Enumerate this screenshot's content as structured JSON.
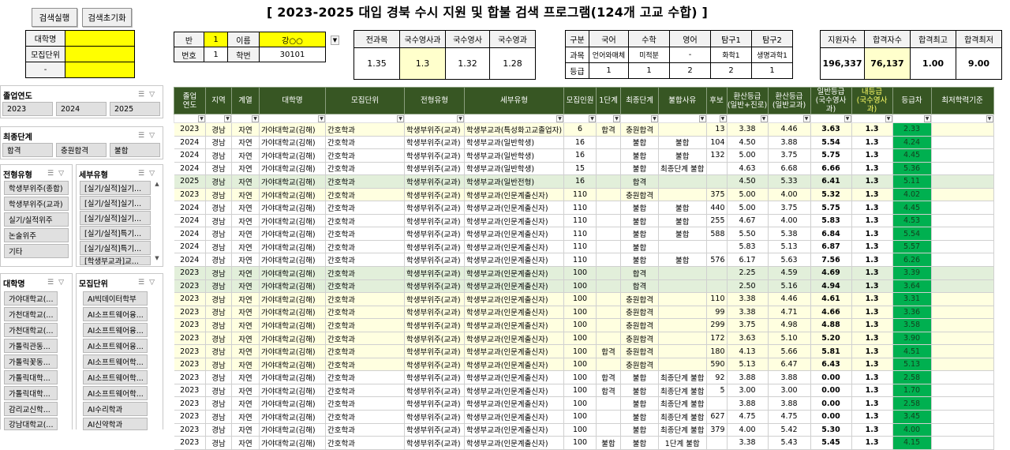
{
  "buttons": {
    "run": "검색실행",
    "reset": "검색초기화"
  },
  "title": "[ 2023-2025 대입 경북 수시 지원 및 합불 검색 프로그램(124개 고교 수합) ]",
  "search_box": {
    "labels": [
      "대학명",
      "모집단위",
      "-"
    ]
  },
  "student": {
    "ban_label": "반",
    "ban": "1",
    "name_label": "이름",
    "name": "강○○",
    "num_label": "번호",
    "num": "1",
    "id_label": "학번",
    "id": "30101"
  },
  "grades": {
    "headers": [
      "전과목",
      "국수영사과",
      "국수영사",
      "국수영과"
    ],
    "values": [
      "1.35",
      "1.3",
      "1.32",
      "1.28"
    ]
  },
  "subjects": {
    "headers": [
      "구분",
      "국어",
      "수학",
      "영어",
      "탐구1",
      "탐구2"
    ],
    "course_label": "과목",
    "courses": [
      "언어와매체",
      "미적분",
      "-",
      "화학1",
      "생명과학1"
    ],
    "grade_label": "등급",
    "grade_vals": [
      "1",
      "1",
      "2",
      "2",
      "1"
    ]
  },
  "stats": {
    "headers": [
      "지원자수",
      "합격자수",
      "합격최고",
      "합격최저"
    ],
    "values": [
      "196,337",
      "76,137",
      "1.00",
      "9.00"
    ]
  },
  "slicers": {
    "year": {
      "title": "졸업연도",
      "items": [
        "2023",
        "2024",
        "2025"
      ]
    },
    "final": {
      "title": "최종단계",
      "items": [
        "합격",
        "충원합격",
        "불합"
      ]
    },
    "type": {
      "title": "전형유형",
      "items": [
        "학생부위주(종합)",
        "학생부위주(교과)",
        "실기/실적위주",
        "논술위주",
        "기타"
      ]
    },
    "detail": {
      "title": "세부유형",
      "items": [
        "[실기/실적]실기...",
        "[실기/실적]실기...",
        "[실기/실적]실기...",
        "[실기/실적]특기...",
        "[실기/실적]특기...",
        "[학생부교과]교..."
      ]
    },
    "univ": {
      "title": "대학명",
      "items": [
        "가야대학교(...",
        "가천대학교(...",
        "가천대학교(...",
        "가톨릭관동...",
        "가톨릭꽃동...",
        "가톨릭대학...",
        "가톨릭대학...",
        "감리교신학...",
        "강남대학교(..."
      ]
    },
    "unit": {
      "title": "모집단위",
      "items": [
        "AI빅데이터학부",
        "AI소프트웨어융...",
        "AI소프트웨어융...",
        "AI소프트웨어융...",
        "AI소프트웨어학...",
        "AI소프트웨어학...",
        "AI소프트웨어학...",
        "AI수리학과",
        "AI신약학과"
      ]
    }
  },
  "table": {
    "headers": [
      "졸업\n연도",
      "지역",
      "계열",
      "대학명",
      "모집단위",
      "전형유형",
      "세부유형",
      "모집인원",
      "1단계",
      "최종단계",
      "불합사유",
      "후보",
      "환산등급\n(일반+진로)",
      "환산등급\n(일반교과)",
      "일반등급\n(국수영사과)",
      "내등급\n(국수영사과)",
      "등급차",
      "최저학력기준"
    ],
    "rows": [
      [
        "2023",
        "경남",
        "자연",
        "가야대학교(김해)",
        "간호학과",
        "학생부위주(교과)",
        "학생부교과(특성화고교졸업자)",
        "6",
        "합격",
        "충원합격",
        "",
        "13",
        "3.38",
        "4.46",
        "3.63",
        "1.3",
        "2.33",
        "",
        "y"
      ],
      [
        "2024",
        "경남",
        "자연",
        "가야대학교(김해)",
        "간호학과",
        "학생부위주(교과)",
        "학생부교과(일반학생)",
        "16",
        "",
        "불합",
        "불합",
        "104",
        "4.50",
        "3.88",
        "5.54",
        "1.3",
        "4.24",
        "",
        "w"
      ],
      [
        "2024",
        "경남",
        "자연",
        "가야대학교(김해)",
        "간호학과",
        "학생부위주(교과)",
        "학생부교과(일반학생)",
        "16",
        "",
        "불합",
        "불합",
        "132",
        "5.00",
        "3.75",
        "5.75",
        "1.3",
        "4.45",
        "",
        "w"
      ],
      [
        "2024",
        "경남",
        "자연",
        "가야대학교(김해)",
        "간호학과",
        "학생부위주(교과)",
        "학생부교과(일반학생)",
        "15",
        "",
        "불합",
        "최종단계 불합",
        "",
        "4.63",
        "6.68",
        "6.66",
        "1.3",
        "5.36",
        "",
        "w"
      ],
      [
        "2025",
        "경남",
        "자연",
        "가야대학교(김해)",
        "간호학과",
        "학생부위주(교과)",
        "학생부교과(일반전형)",
        "16",
        "",
        "합격",
        "",
        "",
        "4.50",
        "5.33",
        "6.41",
        "1.3",
        "5.11",
        "",
        "g"
      ],
      [
        "2023",
        "경남",
        "자연",
        "가야대학교(김해)",
        "간호학과",
        "학생부위주(교과)",
        "학생부교과(인문계출신자)",
        "110",
        "",
        "충원합격",
        "",
        "375",
        "5.00",
        "4.00",
        "5.32",
        "1.3",
        "4.02",
        "",
        "y"
      ],
      [
        "2024",
        "경남",
        "자연",
        "가야대학교(김해)",
        "간호학과",
        "학생부위주(교과)",
        "학생부교과(인문계출신자)",
        "110",
        "",
        "불합",
        "불합",
        "440",
        "5.00",
        "3.75",
        "5.75",
        "1.3",
        "4.45",
        "",
        "w"
      ],
      [
        "2024",
        "경남",
        "자연",
        "가야대학교(김해)",
        "간호학과",
        "학생부위주(교과)",
        "학생부교과(인문계출신자)",
        "110",
        "",
        "불합",
        "불합",
        "255",
        "4.67",
        "4.00",
        "5.83",
        "1.3",
        "4.53",
        "",
        "w"
      ],
      [
        "2024",
        "경남",
        "자연",
        "가야대학교(김해)",
        "간호학과",
        "학생부위주(교과)",
        "학생부교과(인문계출신자)",
        "110",
        "",
        "불합",
        "불합",
        "588",
        "5.50",
        "5.38",
        "6.84",
        "1.3",
        "5.54",
        "",
        "w"
      ],
      [
        "2024",
        "경남",
        "자연",
        "가야대학교(김해)",
        "간호학과",
        "학생부위주(교과)",
        "학생부교과(인문계출신자)",
        "110",
        "",
        "불합",
        "",
        "",
        "5.83",
        "5.13",
        "6.87",
        "1.3",
        "5.57",
        "",
        "w"
      ],
      [
        "2024",
        "경남",
        "자연",
        "가야대학교(김해)",
        "간호학과",
        "학생부위주(교과)",
        "학생부교과(인문계출신자)",
        "110",
        "",
        "불합",
        "불합",
        "576",
        "6.17",
        "5.63",
        "7.56",
        "1.3",
        "6.26",
        "",
        "w"
      ],
      [
        "2023",
        "경남",
        "자연",
        "가야대학교(김해)",
        "간호학과",
        "학생부위주(교과)",
        "학생부교과(인문계출신자)",
        "100",
        "",
        "합격",
        "",
        "",
        "2.25",
        "4.59",
        "4.69",
        "1.3",
        "3.39",
        "",
        "g"
      ],
      [
        "2023",
        "경남",
        "자연",
        "가야대학교(김해)",
        "간호학과",
        "학생부위주(교과)",
        "학생부교과(인문계출신자)",
        "100",
        "",
        "합격",
        "",
        "",
        "2.50",
        "5.16",
        "4.94",
        "1.3",
        "3.64",
        "",
        "g"
      ],
      [
        "2023",
        "경남",
        "자연",
        "가야대학교(김해)",
        "간호학과",
        "학생부위주(교과)",
        "학생부교과(인문계출신자)",
        "100",
        "",
        "충원합격",
        "",
        "110",
        "3.38",
        "4.46",
        "4.61",
        "1.3",
        "3.31",
        "",
        "y"
      ],
      [
        "2023",
        "경남",
        "자연",
        "가야대학교(김해)",
        "간호학과",
        "학생부위주(교과)",
        "학생부교과(인문계출신자)",
        "100",
        "",
        "충원합격",
        "",
        "99",
        "3.38",
        "4.71",
        "4.66",
        "1.3",
        "3.36",
        "",
        "y"
      ],
      [
        "2023",
        "경남",
        "자연",
        "가야대학교(김해)",
        "간호학과",
        "학생부위주(교과)",
        "학생부교과(인문계출신자)",
        "100",
        "",
        "충원합격",
        "",
        "299",
        "3.75",
        "4.98",
        "4.88",
        "1.3",
        "3.58",
        "",
        "y"
      ],
      [
        "2023",
        "경남",
        "자연",
        "가야대학교(김해)",
        "간호학과",
        "학생부위주(교과)",
        "학생부교과(인문계출신자)",
        "100",
        "",
        "충원합격",
        "",
        "172",
        "3.63",
        "5.10",
        "5.20",
        "1.3",
        "3.90",
        "",
        "y"
      ],
      [
        "2023",
        "경남",
        "자연",
        "가야대학교(김해)",
        "간호학과",
        "학생부위주(교과)",
        "학생부교과(인문계출신자)",
        "100",
        "합격",
        "충원합격",
        "",
        "180",
        "4.13",
        "5.66",
        "5.81",
        "1.3",
        "4.51",
        "",
        "y"
      ],
      [
        "2023",
        "경남",
        "자연",
        "가야대학교(김해)",
        "간호학과",
        "학생부위주(교과)",
        "학생부교과(인문계출신자)",
        "100",
        "",
        "충원합격",
        "",
        "590",
        "5.13",
        "6.47",
        "6.43",
        "1.3",
        "5.13",
        "",
        "y"
      ],
      [
        "2023",
        "경남",
        "자연",
        "가야대학교(김해)",
        "간호학과",
        "학생부위주(교과)",
        "학생부교과(인문계출신자)",
        "100",
        "합격",
        "불합",
        "최종단계 불합",
        "92",
        "3.88",
        "3.88",
        "0.00",
        "1.3",
        "2.58",
        "",
        "w"
      ],
      [
        "2023",
        "경남",
        "자연",
        "가야대학교(김해)",
        "간호학과",
        "학생부위주(교과)",
        "학생부교과(인문계출신자)",
        "100",
        "합격",
        "불합",
        "최종단계 불합",
        "5",
        "3.00",
        "3.00",
        "0.00",
        "1.3",
        "1.70",
        "",
        "w"
      ],
      [
        "2023",
        "경남",
        "자연",
        "가야대학교(김해)",
        "간호학과",
        "학생부위주(교과)",
        "학생부교과(인문계출신자)",
        "100",
        "",
        "불합",
        "최종단계 불합",
        "",
        "3.88",
        "3.88",
        "0.00",
        "1.3",
        "2.58",
        "",
        "w"
      ],
      [
        "2023",
        "경남",
        "자연",
        "가야대학교(김해)",
        "간호학과",
        "학생부위주(교과)",
        "학생부교과(인문계출신자)",
        "100",
        "",
        "불합",
        "최종단계 불합",
        "627",
        "4.75",
        "4.75",
        "0.00",
        "1.3",
        "3.45",
        "",
        "w"
      ],
      [
        "2023",
        "경남",
        "자연",
        "가야대학교(김해)",
        "간호학과",
        "학생부위주(교과)",
        "학생부교과(인문계출신자)",
        "100",
        "",
        "불합",
        "최종단계 불합",
        "379",
        "4.00",
        "5.42",
        "5.30",
        "1.3",
        "4.00",
        "",
        "w"
      ],
      [
        "2023",
        "경남",
        "자연",
        "가야대학교(김해)",
        "간호학과",
        "학생부위주(교과)",
        "학생부교과(인문계출신자)",
        "100",
        "불합",
        "불합",
        "1단계 불합",
        "",
        "3.38",
        "5.43",
        "5.45",
        "1.3",
        "4.15",
        "",
        "w"
      ]
    ]
  }
}
